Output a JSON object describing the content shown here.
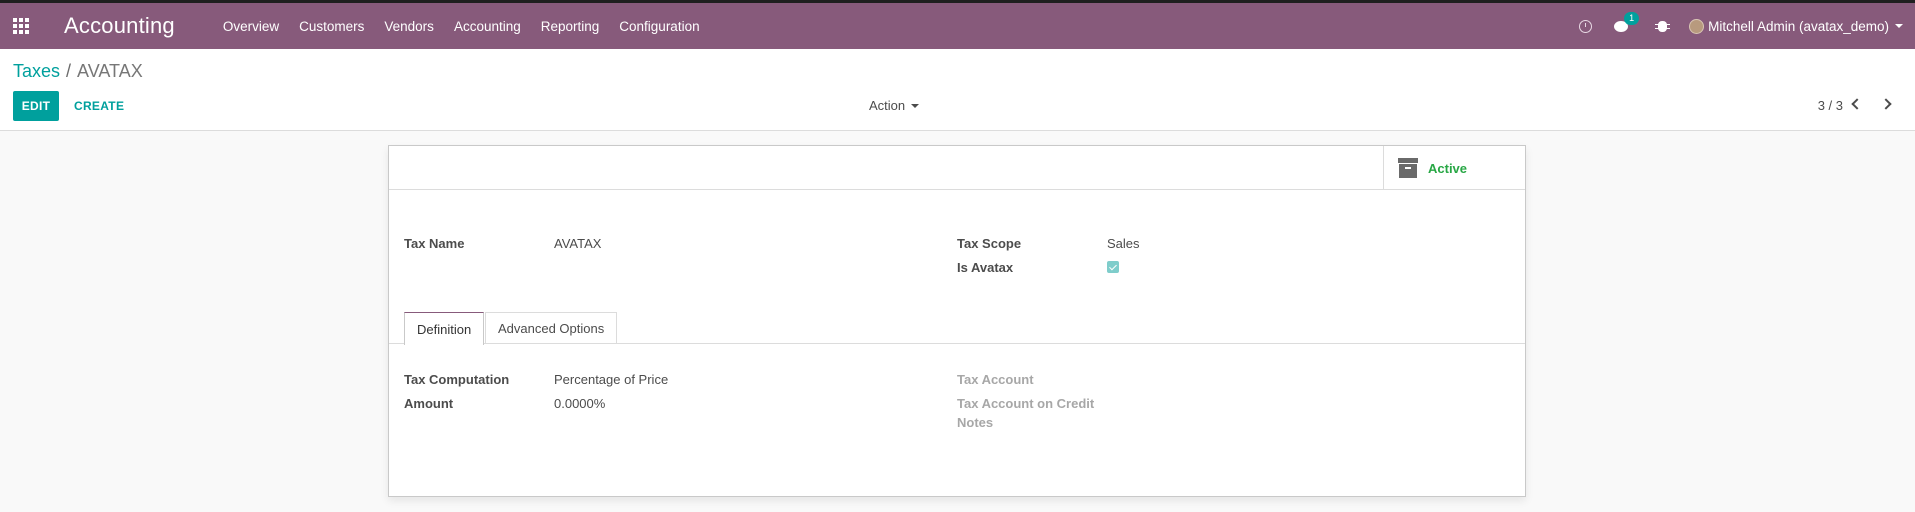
{
  "navbar": {
    "brand": "Accounting",
    "menu": [
      "Overview",
      "Customers",
      "Vendors",
      "Accounting",
      "Reporting",
      "Configuration"
    ],
    "chat_badge": "1",
    "user": "Mitchell Admin (avatax_demo)"
  },
  "breadcrumb": {
    "parent": "Taxes",
    "separator": "/",
    "current": "AVATAX"
  },
  "toolbar": {
    "edit_label": "EDIT",
    "create_label": "CREATE",
    "action_label": "Action",
    "pager": "3 / 3"
  },
  "stat_button": {
    "label": "Active"
  },
  "form": {
    "tax_name_label": "Tax Name",
    "tax_name_value": "AVATAX",
    "tax_scope_label": "Tax Scope",
    "tax_scope_value": "Sales",
    "is_avatax_label": "Is Avatax",
    "is_avatax_checked": true
  },
  "tabs": [
    "Definition",
    "Advanced Options"
  ],
  "definition": {
    "tax_computation_label": "Tax Computation",
    "tax_computation_value": "Percentage of Price",
    "amount_label": "Amount",
    "amount_value": "0.0000%",
    "tax_account_label": "Tax Account",
    "tax_account_credit_label_1": "Tax Account on Credit",
    "tax_account_credit_label_2": "Notes"
  },
  "colors": {
    "navbar": "#875a7b",
    "primary": "#00a09d",
    "active_green": "#28a745"
  }
}
